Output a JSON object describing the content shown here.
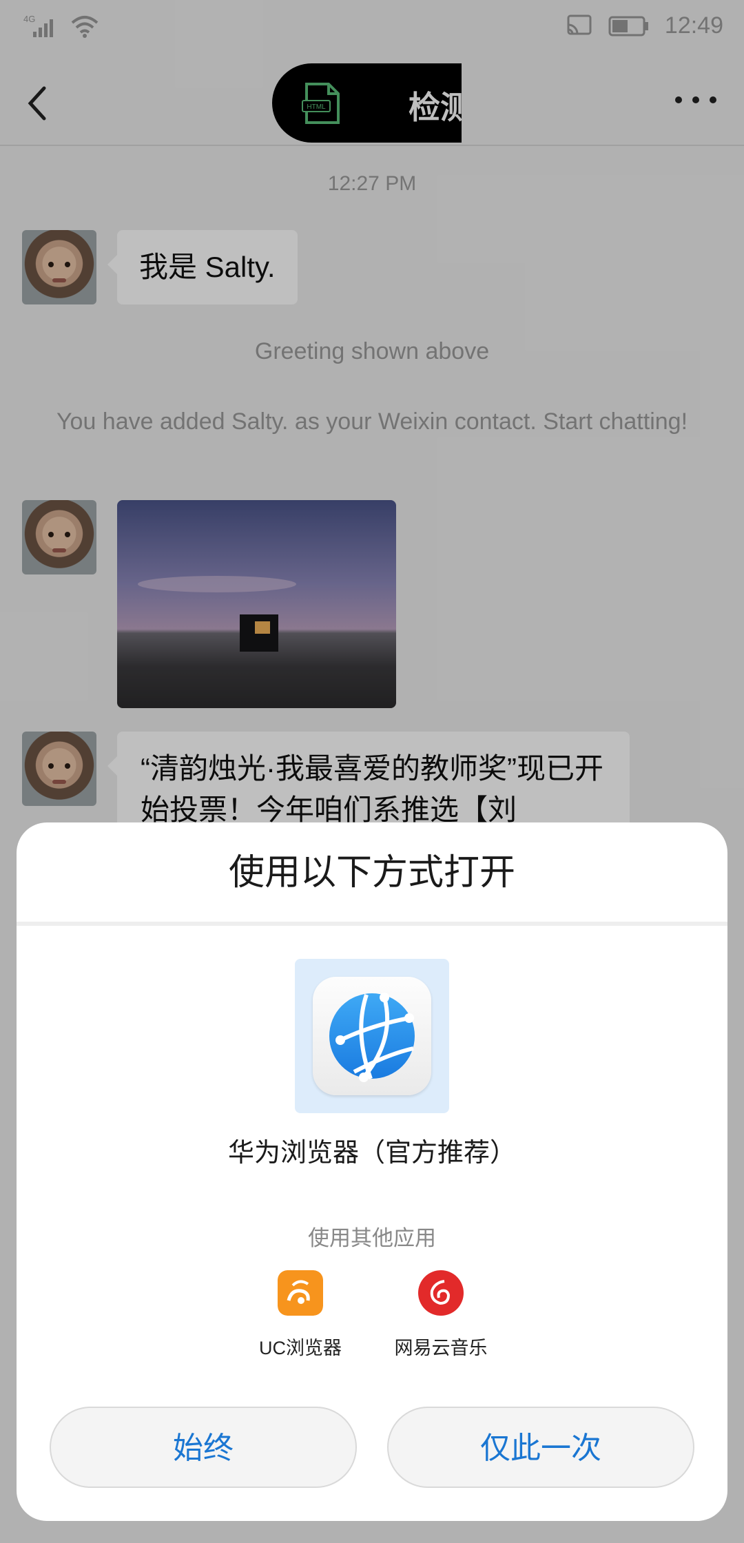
{
  "status_bar": {
    "network": "4G",
    "time": "12:49"
  },
  "header": {
    "title": "检测",
    "file_type": "HTML"
  },
  "chat": {
    "timestamp": "12:27 PM",
    "messages": [
      {
        "type": "text",
        "text": "我是 Salty."
      },
      {
        "type": "system",
        "text": "Greeting shown above"
      },
      {
        "type": "system",
        "text": "You have added Salty. as your Weixin contact. Start chatting!"
      },
      {
        "type": "image"
      },
      {
        "type": "text",
        "text": "“清韵烛光·我最喜爱的教师奖”现已开始投票！今年咱们系推选【刘"
      }
    ]
  },
  "open_with_sheet": {
    "title": "使用以下方式打开",
    "recommended_app": {
      "name": "华为浏览器（官方推荐）",
      "icon": "globe-icon"
    },
    "other_label": "使用其他应用",
    "other_apps": [
      {
        "name": "UC浏览器",
        "icon": "uc-browser-icon",
        "color": "#f7941d"
      },
      {
        "name": "网易云音乐",
        "icon": "netease-music-icon",
        "color": "#e22a2a"
      }
    ],
    "buttons": {
      "always": "始终",
      "once": "仅此一次"
    },
    "accent_color": "#1a76d2"
  }
}
